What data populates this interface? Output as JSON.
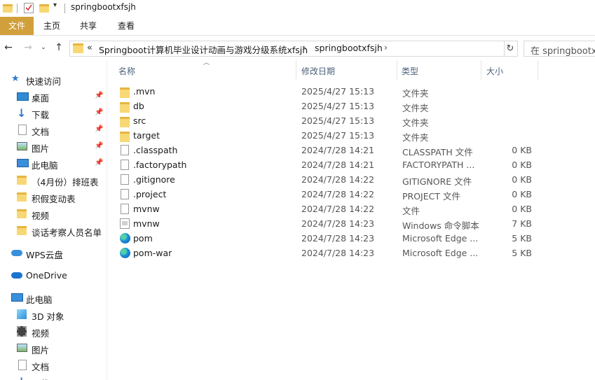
{
  "titlebar": {
    "title": "springbootxfsjh"
  },
  "ribbon": {
    "tabs": [
      "文件",
      "主页",
      "共享",
      "查看"
    ]
  },
  "address": {
    "prefix": "«",
    "crumbs": [
      "Springboot计算机毕业设计动画与游戏分级系统xfsjh",
      "springbootxfsjh"
    ],
    "search_placeholder": "在 springbootxfsjh"
  },
  "nav": {
    "quick_access": "快速访问",
    "pinned": [
      {
        "label": "桌面",
        "icon": "desktop-icon"
      },
      {
        "label": "下载",
        "icon": "download-icon"
      },
      {
        "label": "文档",
        "icon": "document-icon"
      },
      {
        "label": "图片",
        "icon": "pictures-icon"
      },
      {
        "label": "此电脑",
        "icon": "computer-icon"
      }
    ],
    "folders": [
      "（4月份）排班表",
      "积假变动表",
      "视频",
      "谈话考察人员名单"
    ],
    "wps": "WPS云盘",
    "onedrive": "OneDrive",
    "this_pc": "此电脑",
    "pc_items": [
      {
        "label": "3D 对象",
        "icon": "3d-objects-icon"
      },
      {
        "label": "视频",
        "icon": "video-icon"
      },
      {
        "label": "图片",
        "icon": "pictures-icon"
      },
      {
        "label": "文档",
        "icon": "document-icon"
      },
      {
        "label": "下载",
        "icon": "download-icon"
      }
    ]
  },
  "columns": {
    "name": "名称",
    "date": "修改日期",
    "type": "类型",
    "size": "大小"
  },
  "files": [
    {
      "name": ".mvn",
      "date": "2025/4/27 15:13",
      "type": "文件夹",
      "size": "",
      "icon": "folder-icon"
    },
    {
      "name": "db",
      "date": "2025/4/27 15:13",
      "type": "文件夹",
      "size": "",
      "icon": "folder-icon"
    },
    {
      "name": "src",
      "date": "2025/4/27 15:13",
      "type": "文件夹",
      "size": "",
      "icon": "folder-icon"
    },
    {
      "name": "target",
      "date": "2025/4/27 15:13",
      "type": "文件夹",
      "size": "",
      "icon": "folder-icon"
    },
    {
      "name": ".classpath",
      "date": "2024/7/28 14:21",
      "type": "CLASSPATH 文件",
      "size": "0 KB",
      "icon": "file-icon"
    },
    {
      "name": ".factorypath",
      "date": "2024/7/28 14:21",
      "type": "FACTORYPATH ...",
      "size": "0 KB",
      "icon": "file-icon"
    },
    {
      "name": ".gitignore",
      "date": "2024/7/28 14:22",
      "type": "GITIGNORE 文件",
      "size": "0 KB",
      "icon": "file-icon"
    },
    {
      "name": ".project",
      "date": "2024/7/28 14:22",
      "type": "PROJECT 文件",
      "size": "0 KB",
      "icon": "file-icon"
    },
    {
      "name": "mvnw",
      "date": "2024/7/28 14:22",
      "type": "文件",
      "size": "0 KB",
      "icon": "file-icon"
    },
    {
      "name": "mvnw",
      "date": "2024/7/28 14:23",
      "type": "Windows 命令脚本",
      "size": "7 KB",
      "icon": "cmd-script-icon"
    },
    {
      "name": "pom",
      "date": "2024/7/28 14:23",
      "type": "Microsoft Edge ...",
      "size": "5 KB",
      "icon": "edge-icon"
    },
    {
      "name": "pom-war",
      "date": "2024/7/28 14:23",
      "type": "Microsoft Edge ...",
      "size": "5 KB",
      "icon": "edge-icon"
    }
  ]
}
